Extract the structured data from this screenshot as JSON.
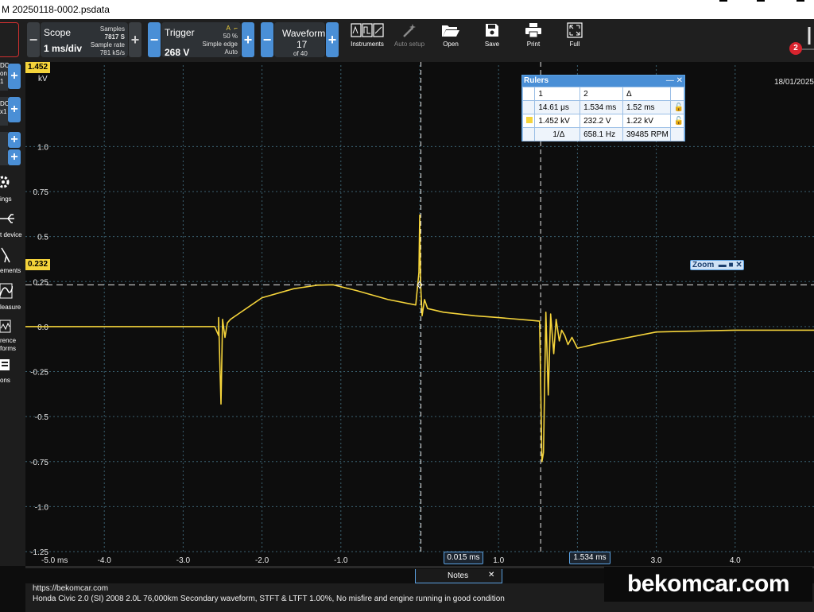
{
  "window": {
    "title": "M 20250118-0002.psdata"
  },
  "toolbar": {
    "scope": {
      "title": "Scope",
      "value": "1 ms/div",
      "samples_label": "Samples",
      "samples": "7817 S",
      "sample_rate_label": "Sample rate",
      "sample_rate": "781 kS/s"
    },
    "trigger": {
      "title": "Trigger",
      "value": "268 V",
      "percent": "50 %",
      "type": "Simple edge",
      "mode": "Auto"
    },
    "waveform": {
      "title": "Waveform",
      "current": "17",
      "total": "of 40"
    },
    "buttons": {
      "instruments": "Instruments",
      "auto_setup": "Auto setup",
      "open": "Open",
      "save": "Save",
      "print": "Print",
      "full": "Full"
    },
    "notification_count": "2"
  },
  "sidebar": {
    "ch1_line1": "DC",
    "ch1_line2": "on",
    "ch1_line3": "1",
    "ch2_line1": "DC",
    "ch2_line2": "x1",
    "items": [
      "ings",
      "t device",
      "ements",
      "leasure",
      "rence",
      "forms",
      "ons"
    ]
  },
  "scope": {
    "y_unit": "kV",
    "y_max_marker": "1.452",
    "ruler_marker": "0.232",
    "date": "18/01/2025",
    "ruler1_label": "0.015 ms",
    "ruler2_label": "1.534 ms",
    "trace_color": "#f5d43b",
    "grid_color": "#3a6070"
  },
  "rulers": {
    "title": "Rulers",
    "col1": "1",
    "col2": "2",
    "col3": "Δ",
    "time1": "14.61 μs",
    "time2": "1.534 ms",
    "time_delta": "1.52 ms",
    "volt1": "1.452 kV",
    "volt2": "232.2 V",
    "volt_delta": "1.22 kV",
    "freq_label": "1/Δ",
    "freq": "658.1 Hz",
    "rpm": "39485 RPM"
  },
  "zoom": {
    "label": "Zoom"
  },
  "notes": {
    "tab": "Notes",
    "line1": "https://bekomcar.com",
    "line2": "Honda Civic 2.0 (SI) 2008 2.0L 76,000km Secondary waveform, STFT & LTFT 1.00%, No misfire and engine running in good condition"
  },
  "watermark": "bekomcar.com",
  "chart_data": {
    "type": "line",
    "xlabel": "",
    "ylabel": "kV",
    "xlim": [
      -5.0,
      5.0
    ],
    "ylim": [
      -1.25,
      1.452
    ],
    "x_ticks": [
      "-5.0 ms",
      "-4.0",
      "-3.0",
      "-2.0",
      "-1.0",
      "1.0",
      "2.0",
      "3.0",
      "4.0"
    ],
    "y_ticks": [
      "1.0",
      "0.75",
      "0.5",
      "0.25",
      "0.0",
      "-0.25",
      "-0.5",
      "-0.75",
      "-1.0",
      "-1.25"
    ],
    "series": [
      {
        "x": [
          -5.0,
          -4.0,
          -3.0,
          -2.6,
          -2.55,
          -2.55,
          -2.52,
          -2.5,
          -2.47,
          -2.44,
          -2.4,
          -2.3,
          -2.0,
          -1.6,
          -1.3,
          -1.1,
          -0.8,
          -0.4,
          -0.05,
          -0.01,
          0.0,
          0.01,
          0.03,
          0.06,
          0.1,
          0.3,
          0.7,
          1.0,
          1.4,
          1.52,
          1.55,
          1.57,
          1.6,
          1.63,
          1.66,
          1.7,
          1.73,
          1.77,
          1.8,
          1.84,
          1.88,
          1.93,
          2.0,
          2.3,
          3.0,
          4.0,
          5.0
        ],
        "y": [
          0.0,
          0.0,
          0.0,
          0.0,
          -0.05,
          0.05,
          -0.43,
          0.04,
          -0.06,
          0.02,
          0.04,
          0.07,
          0.16,
          0.21,
          0.23,
          0.232,
          0.2,
          0.15,
          0.12,
          0.3,
          0.62,
          0.25,
          0.06,
          0.15,
          0.1,
          0.08,
          0.06,
          0.05,
          0.035,
          0.03,
          -0.75,
          -0.7,
          0.08,
          -0.38,
          0.07,
          -0.15,
          0.04,
          -0.08,
          -0.02,
          -0.05,
          -0.1,
          -0.06,
          -0.12,
          -0.09,
          -0.03,
          -0.02,
          -0.02
        ]
      }
    ]
  }
}
